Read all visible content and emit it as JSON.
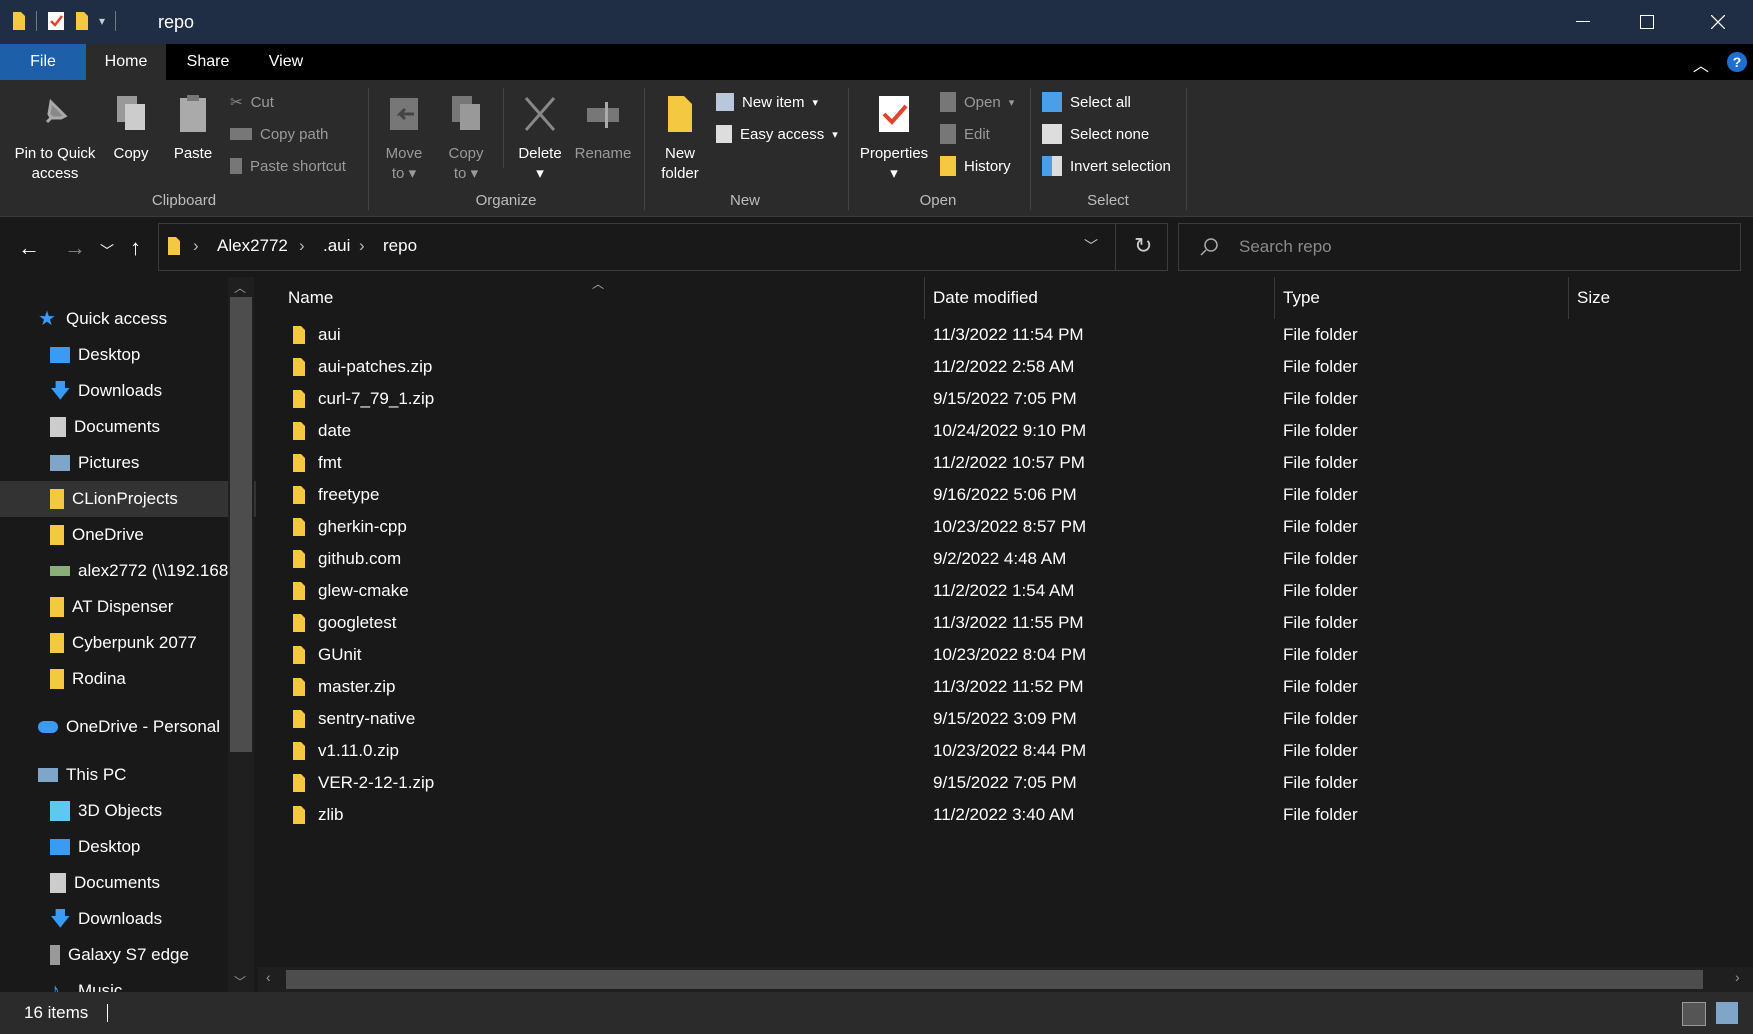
{
  "window": {
    "title": "repo",
    "minimize_icon": "minimize-icon",
    "maximize_icon": "maximize-icon",
    "close_icon": "close-icon"
  },
  "menu": {
    "tabs": [
      "File",
      "Home",
      "Share",
      "View"
    ],
    "active_tab": "Home"
  },
  "ribbon": {
    "clipboard": {
      "label": "Clipboard",
      "pin": "Pin to Quick access",
      "pin_line1": "Pin to Quick",
      "pin_line2": "access",
      "copy": "Copy",
      "paste": "Paste",
      "cut": "Cut",
      "copy_path": "Copy path",
      "paste_shortcut": "Paste shortcut"
    },
    "organize": {
      "label": "Organize",
      "move_line1": "Move",
      "move_line2": "to",
      "copy_line1": "Copy",
      "copy_line2": "to",
      "delete": "Delete",
      "rename": "Rename"
    },
    "new": {
      "label": "New",
      "new_folder_line1": "New",
      "new_folder_line2": "folder",
      "new_item": "New item",
      "easy_access": "Easy access"
    },
    "open": {
      "label": "Open",
      "properties": "Properties",
      "open": "Open",
      "edit": "Edit",
      "history": "History"
    },
    "select": {
      "label": "Select",
      "select_all": "Select all",
      "select_none": "Select none",
      "invert_selection": "Invert selection"
    }
  },
  "address": {
    "crumbs": [
      "Alex2772",
      ".aui",
      "repo"
    ],
    "search_placeholder": "Search repo"
  },
  "sidebar": {
    "quick_access": "Quick access",
    "quick_items": [
      {
        "label": "Desktop",
        "pinned": true
      },
      {
        "label": "Downloads",
        "pinned": true
      },
      {
        "label": "Documents",
        "pinned": true
      },
      {
        "label": "Pictures",
        "pinned": true
      },
      {
        "label": "CLionProjects",
        "pinned": true
      },
      {
        "label": "OneDrive",
        "pinned": true
      },
      {
        "label": "alex2772 (\\\\192.168",
        "pinned": false
      },
      {
        "label": "AT Dispenser",
        "pinned": false
      },
      {
        "label": "Cyberpunk 2077",
        "pinned": false
      },
      {
        "label": "Rodina",
        "pinned": false
      }
    ],
    "onedrive": "OneDrive - Personal",
    "this_pc": "This PC",
    "pc_items": [
      "3D Objects",
      "Desktop",
      "Documents",
      "Downloads",
      "Galaxy S7 edge",
      "Music"
    ]
  },
  "columns": {
    "name": "Name",
    "date": "Date modified",
    "type": "Type",
    "size": "Size"
  },
  "files": [
    {
      "name": "aui",
      "date": "11/3/2022 11:54 PM",
      "type": "File folder"
    },
    {
      "name": "aui-patches.zip",
      "date": "11/2/2022 2:58 AM",
      "type": "File folder"
    },
    {
      "name": "curl-7_79_1.zip",
      "date": "9/15/2022 7:05 PM",
      "type": "File folder"
    },
    {
      "name": "date",
      "date": "10/24/2022 9:10 PM",
      "type": "File folder"
    },
    {
      "name": "fmt",
      "date": "11/2/2022 10:57 PM",
      "type": "File folder"
    },
    {
      "name": "freetype",
      "date": "9/16/2022 5:06 PM",
      "type": "File folder"
    },
    {
      "name": "gherkin-cpp",
      "date": "10/23/2022 8:57 PM",
      "type": "File folder"
    },
    {
      "name": "github.com",
      "date": "9/2/2022 4:48 AM",
      "type": "File folder"
    },
    {
      "name": "glew-cmake",
      "date": "11/2/2022 1:54 AM",
      "type": "File folder"
    },
    {
      "name": "googletest",
      "date": "11/3/2022 11:55 PM",
      "type": "File folder"
    },
    {
      "name": "GUnit",
      "date": "10/23/2022 8:04 PM",
      "type": "File folder"
    },
    {
      "name": "master.zip",
      "date": "11/3/2022 11:52 PM",
      "type": "File folder"
    },
    {
      "name": "sentry-native",
      "date": "9/15/2022 3:09 PM",
      "type": "File folder"
    },
    {
      "name": "v1.11.0.zip",
      "date": "10/23/2022 8:44 PM",
      "type": "File folder"
    },
    {
      "name": "VER-2-12-1.zip",
      "date": "9/15/2022 7:05 PM",
      "type": "File folder"
    },
    {
      "name": "zlib",
      "date": "11/2/2022 3:40 AM",
      "type": "File folder"
    }
  ],
  "status": {
    "count": "16 items"
  },
  "colors": {
    "titlebar": "#1f2e45",
    "file_tab": "#1d5fa8",
    "folder": "#f5c842",
    "background": "#191919"
  }
}
